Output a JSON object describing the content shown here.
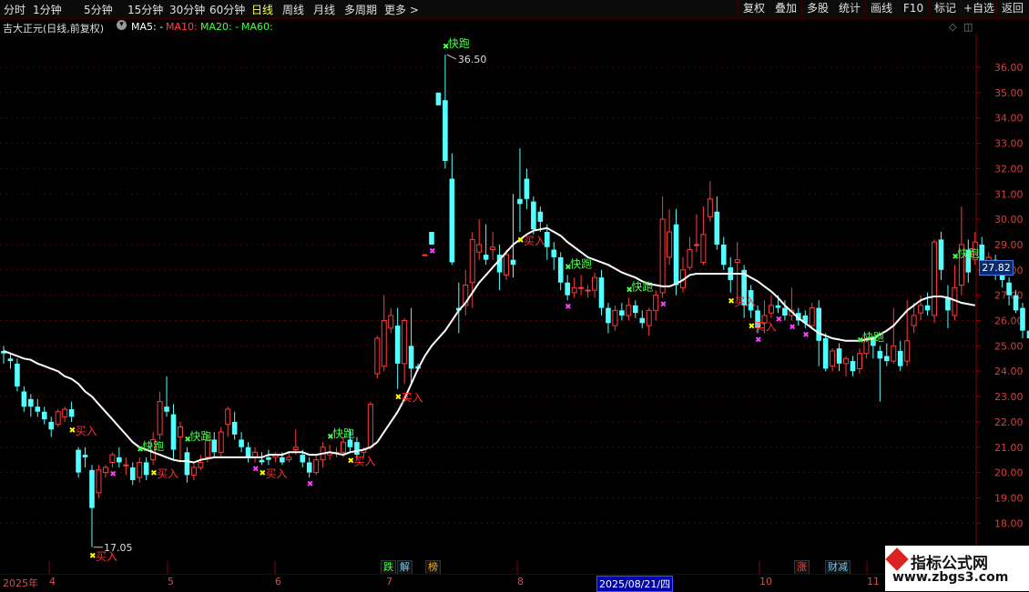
{
  "toolbar": {
    "timeframes": [
      "分时",
      "1分钟",
      "5分钟",
      "15分钟",
      "30分钟",
      "60分钟",
      "日线",
      "周线",
      "月线",
      "多周期",
      "更多 >"
    ],
    "active_timeframe": "日线",
    "right_buttons": [
      "复权",
      "叠加",
      "多股",
      "统计",
      "画线",
      "F10",
      "标记",
      "+自选",
      "返回"
    ]
  },
  "info": {
    "stock_title": "吉大正元(日线,前复权)",
    "ma5": "MA5: -",
    "ma10": "MA10: -",
    "ma20": "MA20: -",
    "ma60": "MA60:"
  },
  "price_axis": {
    "ticks": [
      "36.00",
      "35.00",
      "34.00",
      "33.00",
      "32.00",
      "31.00",
      "30.00",
      "29.00",
      "28.00",
      "27.00",
      "26.00",
      "25.00",
      "24.00",
      "23.00",
      "22.00",
      "21.00",
      "20.00",
      "19.00",
      "18.00"
    ],
    "current_price": "27.82"
  },
  "annotations": {
    "high_label": "36.50",
    "low_label": "17.05",
    "sell_label": "快跑",
    "buy_label": "买入"
  },
  "date_axis": {
    "year_label": "2025年",
    "months": [
      "4",
      "5",
      "6",
      "7",
      "8",
      "10",
      "11"
    ],
    "highlight_date": "2025/08/21/四"
  },
  "badges": [
    "跌",
    "解",
    "榜",
    "涨",
    "财减"
  ],
  "watermark": {
    "line1": "指标公式网",
    "line2": "www.zbgs3.com"
  },
  "colors": {
    "up": "#ff3c3c",
    "down": "#54ffff",
    "ma": "#ffffff",
    "sell": "#44ff44",
    "buy": "#ffff00",
    "flag": "#ff40ff"
  },
  "chart_data": {
    "type": "candlestick",
    "ylim": [
      17.0,
      37.0
    ],
    "candles": [
      [
        24.8,
        24.7,
        25.0,
        24.3
      ],
      [
        24.5,
        24.4,
        24.7,
        24.1
      ],
      [
        24.3,
        23.4,
        24.5,
        23.2
      ],
      [
        23.2,
        22.6,
        23.4,
        22.4
      ],
      [
        22.9,
        22.6,
        23.1,
        22.2
      ],
      [
        22.6,
        22.4,
        22.9,
        22.2
      ],
      [
        22.4,
        22.1,
        22.6,
        21.9
      ],
      [
        22.0,
        21.7,
        22.2,
        21.4
      ],
      [
        21.9,
        22.4,
        22.5,
        21.8
      ],
      [
        22.2,
        22.5,
        22.6,
        22.0
      ],
      [
        22.5,
        22.2,
        22.8,
        22.0
      ],
      [
        20.9,
        20.0,
        21.0,
        19.8
      ],
      [
        20.7,
        20.6,
        21.0,
        20.2
      ],
      [
        20.1,
        18.6,
        20.3,
        17.05
      ],
      [
        19.2,
        20.1,
        20.3,
        19.0
      ],
      [
        20.0,
        20.2,
        20.3,
        19.8
      ],
      [
        20.4,
        20.7,
        20.8,
        20.2
      ],
      [
        20.6,
        20.4,
        21.0,
        20.2
      ],
      [
        20.3,
        20.3,
        20.6,
        19.9
      ],
      [
        20.2,
        19.7,
        20.4,
        19.5
      ],
      [
        19.8,
        20.4,
        20.6,
        19.6
      ],
      [
        20.4,
        19.9,
        20.6,
        19.7
      ],
      [
        20.5,
        21.3,
        21.6,
        20.3
      ],
      [
        21.5,
        22.8,
        23.2,
        21.3
      ],
      [
        22.6,
        22.4,
        23.8,
        22.2
      ],
      [
        22.3,
        20.9,
        22.7,
        20.5
      ],
      [
        21.4,
        21.8,
        22.0,
        20.4
      ],
      [
        20.8,
        19.9,
        21.0,
        19.6
      ],
      [
        19.9,
        20.2,
        20.4,
        19.7
      ],
      [
        20.2,
        20.4,
        20.7,
        20.1
      ],
      [
        20.6,
        21.3,
        21.5,
        20.4
      ],
      [
        21.3,
        20.8,
        21.6,
        20.6
      ],
      [
        20.8,
        21.6,
        21.8,
        20.6
      ],
      [
        21.9,
        22.5,
        22.6,
        21.4
      ],
      [
        22.0,
        21.5,
        22.4,
        21.3
      ],
      [
        21.3,
        21.0,
        21.6,
        20.8
      ],
      [
        21.0,
        20.6,
        21.2,
        20.4
      ],
      [
        20.6,
        20.8,
        21.0,
        20.4
      ],
      [
        20.5,
        20.4,
        20.8,
        20.3
      ],
      [
        20.6,
        20.5,
        20.9,
        20.3
      ],
      [
        20.6,
        20.7,
        20.8,
        20.4
      ],
      [
        20.6,
        20.4,
        20.8,
        20.3
      ],
      [
        20.5,
        20.6,
        20.8,
        20.4
      ],
      [
        20.9,
        21.0,
        21.7,
        20.7
      ],
      [
        20.7,
        20.4,
        20.9,
        20.2
      ],
      [
        20.4,
        20.0,
        20.6,
        19.8
      ],
      [
        20.0,
        20.5,
        20.7,
        19.9
      ],
      [
        20.5,
        21.0,
        21.2,
        20.2
      ],
      [
        20.7,
        20.8,
        21.1,
        20.5
      ],
      [
        20.8,
        20.8,
        21.0,
        20.6
      ],
      [
        20.8,
        21.2,
        21.4,
        20.6
      ],
      [
        21.3,
        21.0,
        21.7,
        20.8
      ],
      [
        21.2,
        20.7,
        21.4,
        20.5
      ],
      [
        20.8,
        20.9,
        21.0,
        20.6
      ],
      [
        21.0,
        22.7,
        22.8,
        20.9
      ],
      [
        23.9,
        25.3,
        25.4,
        23.7
      ],
      [
        24.2,
        26.0,
        27.0,
        24.0
      ],
      [
        25.7,
        26.2,
        26.5,
        25.5
      ],
      [
        25.8,
        24.3,
        26.5,
        23.3
      ],
      [
        24.3,
        26.0,
        26.1,
        23.5
      ],
      [
        25.0,
        24.1,
        26.5,
        23.5
      ],
      [
        24.2,
        24.1,
        24.3,
        24.0
      ],
      [
        28.6,
        28.6,
        28.6,
        28.6
      ],
      [
        29.5,
        29.0,
        29.5,
        29.0
      ],
      [
        35.0,
        34.5,
        35.0,
        34.5
      ],
      [
        34.7,
        32.3,
        36.5,
        32.0
      ],
      [
        31.6,
        28.3,
        32.6,
        28.2
      ],
      [
        26.5,
        26.4,
        27.5,
        25.5
      ],
      [
        26.6,
        27.4,
        28.0,
        26.2
      ],
      [
        27.5,
        29.2,
        29.5,
        26.5
      ],
      [
        28.7,
        29.0,
        30.0,
        28.4
      ],
      [
        28.6,
        28.4,
        29.8,
        28.2
      ],
      [
        28.8,
        28.9,
        29.5,
        28.4
      ],
      [
        28.6,
        27.9,
        29.0,
        27.2
      ],
      [
        27.8,
        28.6,
        28.8,
        27.6
      ],
      [
        28.4,
        28.2,
        31.0,
        27.7
      ],
      [
        30.8,
        30.6,
        32.8,
        29.5
      ],
      [
        31.6,
        30.8,
        32.0,
        30.4
      ],
      [
        30.7,
        29.6,
        30.9,
        29.4
      ],
      [
        30.3,
        29.9,
        30.5,
        29.5
      ],
      [
        29.5,
        28.9,
        29.8,
        28.4
      ],
      [
        28.8,
        28.5,
        29.1,
        28.0
      ],
      [
        28.5,
        27.5,
        28.7,
        27.2
      ],
      [
        27.5,
        27.0,
        27.8,
        26.8
      ],
      [
        27.1,
        27.3,
        27.7,
        26.9
      ],
      [
        27.3,
        27.3,
        27.8,
        27.0
      ],
      [
        27.2,
        27.2,
        27.4,
        26.9
      ],
      [
        27.2,
        27.7,
        27.9,
        26.9
      ],
      [
        27.7,
        26.5,
        28.0,
        26.2
      ],
      [
        26.5,
        25.9,
        26.7,
        25.5
      ],
      [
        25.8,
        26.4,
        26.6,
        25.6
      ],
      [
        26.4,
        26.2,
        26.7,
        26.0
      ],
      [
        26.2,
        26.6,
        26.9,
        26.0
      ],
      [
        26.6,
        26.3,
        26.8,
        26.1
      ],
      [
        26.1,
        25.9,
        26.4,
        25.7
      ],
      [
        25.8,
        26.4,
        26.5,
        25.4
      ],
      [
        26.4,
        27.0,
        27.2,
        26.0
      ],
      [
        27.1,
        30.0,
        30.9,
        26.9
      ],
      [
        28.5,
        29.5,
        30.4,
        28.2
      ],
      [
        29.8,
        27.4,
        30.4,
        27.0
      ],
      [
        27.3,
        28.0,
        28.5,
        27.1
      ],
      [
        28.1,
        28.8,
        29.3,
        28.0
      ],
      [
        29.0,
        29.0,
        30.2,
        28.7
      ],
      [
        28.3,
        29.4,
        30.5,
        28.2
      ],
      [
        30.1,
        30.8,
        31.5,
        29.9
      ],
      [
        30.3,
        29.0,
        30.9,
        28.8
      ],
      [
        29.0,
        28.2,
        29.3,
        28.0
      ],
      [
        28.1,
        27.6,
        28.5,
        27.1
      ],
      [
        28.3,
        28.4,
        29.1,
        26.8
      ],
      [
        28.0,
        26.6,
        28.2,
        26.1
      ],
      [
        27.2,
        26.4,
        27.4,
        26.1
      ],
      [
        26.4,
        25.7,
        26.6,
        25.5
      ],
      [
        25.9,
        26.2,
        26.8,
        25.5
      ],
      [
        26.3,
        26.6,
        27.0,
        26.1
      ],
      [
        26.6,
        26.5,
        27.0,
        26.3
      ],
      [
        26.5,
        26.2,
        26.8,
        26.0
      ],
      [
        26.2,
        26.4,
        27.3,
        26.0
      ],
      [
        26.3,
        26.0,
        26.5,
        25.8
      ],
      [
        26.2,
        25.9,
        26.4,
        25.7
      ],
      [
        25.8,
        26.5,
        26.7,
        25.7
      ],
      [
        26.5,
        25.2,
        26.8,
        24.2
      ],
      [
        25.3,
        24.1,
        25.5,
        24.0
      ],
      [
        24.2,
        24.8,
        24.9,
        24.0
      ],
      [
        24.9,
        24.3,
        25.1,
        24.0
      ],
      [
        24.3,
        24.5,
        24.6,
        23.8
      ],
      [
        24.4,
        24.0,
        24.6,
        23.8
      ],
      [
        24.1,
        24.7,
        24.9,
        23.9
      ],
      [
        24.7,
        25.3,
        25.4,
        24.5
      ],
      [
        25.3,
        25.0,
        25.4,
        24.5
      ],
      [
        24.8,
        24.5,
        25.0,
        22.8
      ],
      [
        24.6,
        24.4,
        25.1,
        24.2
      ],
      [
        24.4,
        25.0,
        26.5,
        24.3
      ],
      [
        24.8,
        24.2,
        25.2,
        24.0
      ],
      [
        24.4,
        25.2,
        26.8,
        24.2
      ],
      [
        25.8,
        26.2,
        26.7,
        25.5
      ],
      [
        26.3,
        26.6,
        27.0,
        26.0
      ],
      [
        26.6,
        26.4,
        27.1,
        26.2
      ],
      [
        26.2,
        29.1,
        29.2,
        25.9
      ],
      [
        29.2,
        28.0,
        29.5,
        27.6
      ],
      [
        26.9,
        26.4,
        27.4,
        25.7
      ],
      [
        26.2,
        27.3,
        28.2,
        26.0
      ],
      [
        27.4,
        29.0,
        30.5,
        27.0
      ],
      [
        28.8,
        27.9,
        29.2,
        27.5
      ],
      [
        28.4,
        29.1,
        29.5,
        28.2
      ],
      [
        29.0,
        28.1,
        29.3,
        27.9
      ],
      [
        28.0,
        28.5,
        28.7,
        27.8
      ],
      [
        28.4,
        27.8,
        28.6,
        27.6
      ],
      [
        27.9,
        27.6,
        28.1,
        27.3
      ],
      [
        27.5,
        27.0,
        27.7,
        26.6
      ],
      [
        27.0,
        26.4,
        27.2,
        26.3
      ],
      [
        26.5,
        25.6,
        26.7,
        25.3
      ],
      [
        25.6,
        25.3,
        25.9,
        25.2
      ],
      [
        25.3,
        25.7,
        26.0,
        25.2
      ],
      [
        25.6,
        25.2,
        25.9,
        25.1
      ],
      [
        25.7,
        26.1,
        26.4,
        25.5
      ],
      [
        26.1,
        25.4,
        26.2,
        25.2
      ],
      [
        25.3,
        25.6,
        26.0,
        25.1
      ],
      [
        25.5,
        25.1,
        25.8,
        24.9
      ],
      [
        25.1,
        24.1,
        25.3,
        23.9
      ],
      [
        24.4,
        25.8,
        26.0,
        24.2
      ],
      [
        25.8,
        26.3,
        26.8,
        25.6
      ],
      [
        26.2,
        25.8,
        26.5,
        25.7
      ],
      [
        25.5,
        25.3,
        25.7,
        25.2
      ]
    ],
    "ma_line": [
      24.8,
      24.7,
      24.6,
      24.5,
      24.45,
      24.3,
      24.2,
      24.1,
      24.0,
      23.8,
      23.7,
      23.5,
      23.2,
      23.0,
      22.7,
      22.4,
      22.1,
      21.8,
      21.5,
      21.2,
      21.0,
      20.9,
      20.8,
      20.7,
      20.6,
      20.5,
      20.45,
      20.45,
      20.4,
      20.5,
      20.55,
      20.6,
      20.6,
      20.6,
      20.6,
      20.6,
      20.6,
      20.6,
      20.6,
      20.7,
      20.7,
      20.7,
      20.8,
      20.8,
      20.8,
      20.7,
      20.7,
      20.75,
      20.8,
      20.75,
      20.7,
      20.8,
      20.85,
      20.9,
      21.0,
      21.2,
      21.6,
      22.0,
      22.4,
      22.9,
      23.5,
      24.1,
      24.6,
      25.0,
      25.3,
      25.6,
      26.0,
      26.4,
      26.7,
      27.1,
      27.5,
      27.8,
      28.1,
      28.4,
      28.7,
      29.0,
      29.2,
      29.4,
      29.55,
      29.6,
      29.65,
      29.5,
      29.35,
      29.1,
      28.9,
      28.7,
      28.5,
      28.4,
      28.3,
      28.2,
      28.05,
      27.9,
      27.8,
      27.7,
      27.55,
      27.45,
      27.4,
      27.35,
      27.35,
      27.45,
      27.6,
      27.8,
      27.85,
      27.85,
      27.85,
      27.85,
      27.85,
      27.85,
      27.85,
      27.85,
      27.7,
      27.55,
      27.35,
      27.15,
      26.9,
      26.6,
      26.35,
      26.1,
      25.9,
      25.7,
      25.5,
      25.4,
      25.3,
      25.25,
      25.2,
      25.2,
      25.2,
      25.25,
      25.3,
      25.45,
      25.6,
      25.8,
      26.1,
      26.4,
      26.6,
      26.8,
      26.9,
      26.95,
      26.95,
      26.9,
      26.8,
      26.7,
      26.65,
      26.6
    ],
    "sell_signals": [
      62,
      126
    ],
    "buy_signals": [
      13,
      21
    ],
    "high": 36.5,
    "low": 17.05
  }
}
